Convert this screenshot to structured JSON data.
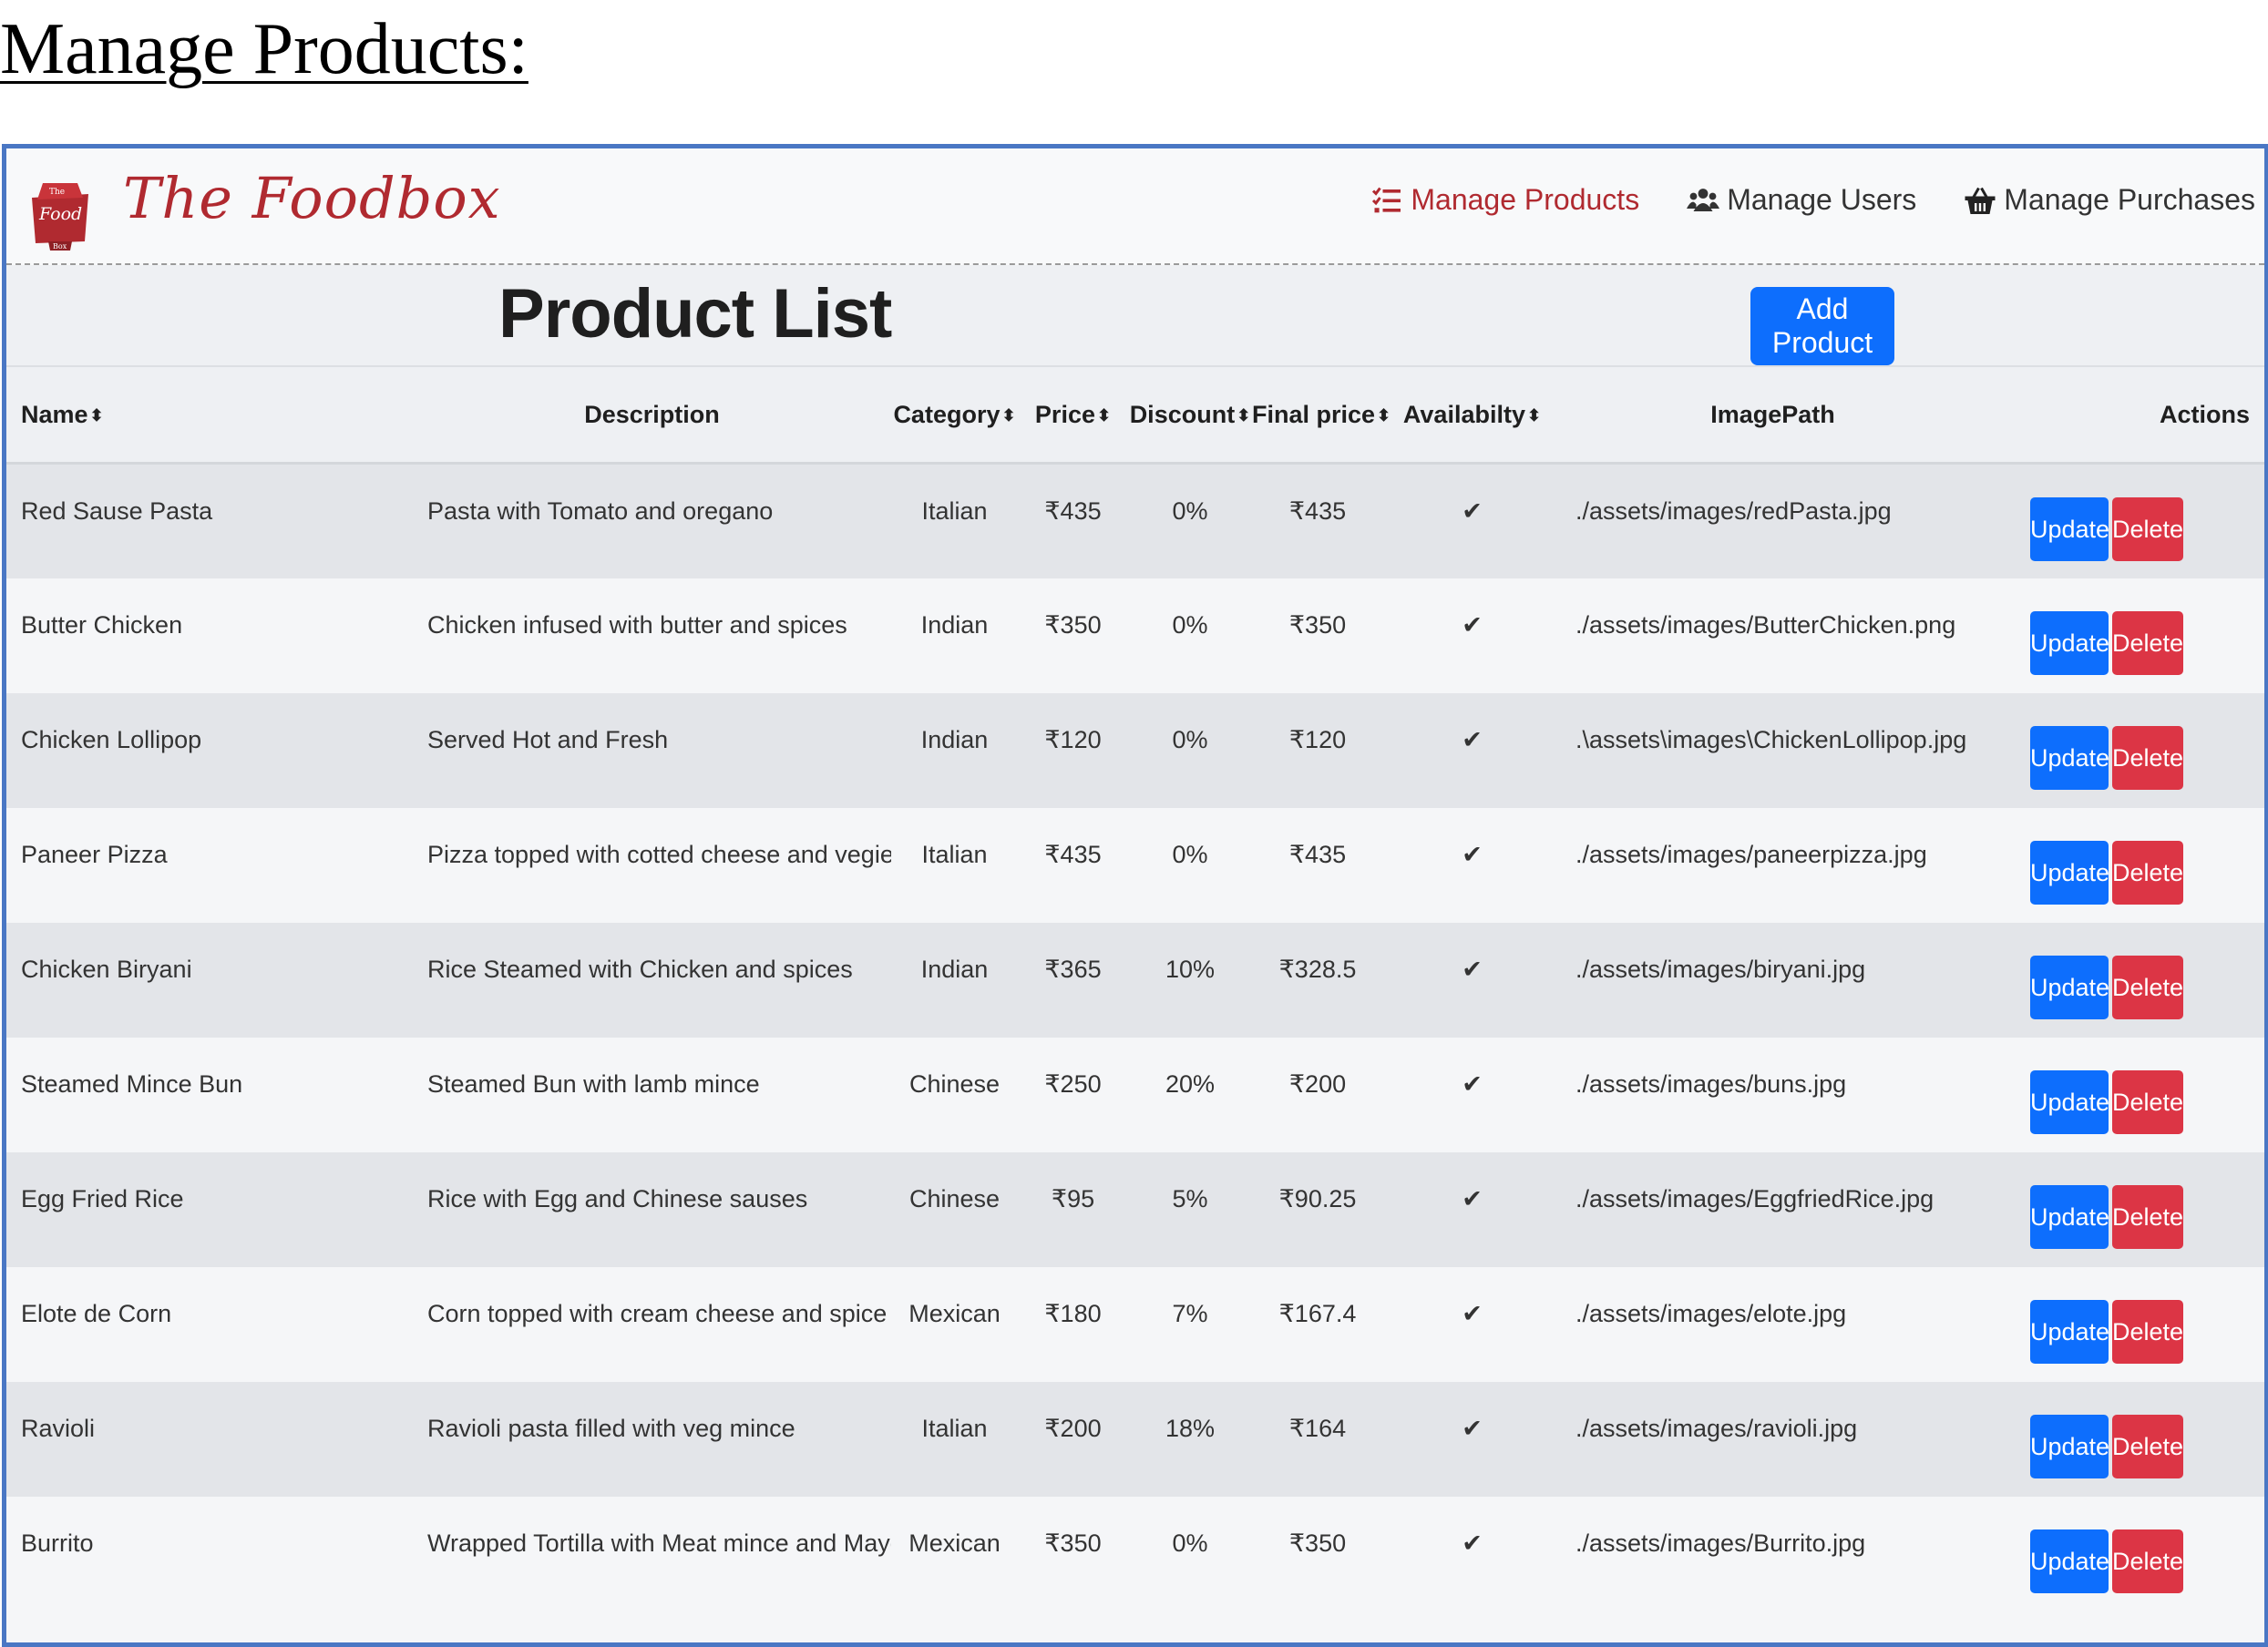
{
  "doc_heading": "Manage Products:",
  "app": {
    "logo_badge_text": [
      "The",
      "Food",
      "Box"
    ],
    "logo_text": "The Foodbox",
    "brand_color": "#b02a30",
    "nav": [
      {
        "label": "Manage Products",
        "icon": "list-check-icon",
        "active": true
      },
      {
        "label": "Manage Users",
        "icon": "users-icon",
        "active": false
      },
      {
        "label": "Manage Purchases",
        "icon": "shopping-basket-icon",
        "active": false
      }
    ]
  },
  "page": {
    "title": "Product List",
    "add_button": "Add Product"
  },
  "table": {
    "columns": {
      "name": "Name",
      "description": "Description",
      "category": "Category",
      "price": "Price",
      "discount": "Discount",
      "final_price": "Final price",
      "availability": "Availabilty",
      "image_path": "ImagePath",
      "actions": "Actions"
    },
    "sort_icon": "sort-icon",
    "update_label": "Update",
    "delete_label": "Delete",
    "rows": [
      {
        "name": "Red Sause Pasta",
        "description": "Pasta with Tomato and oregano",
        "category": "Italian",
        "price": "₹435",
        "discount": "0%",
        "final_price": "₹435",
        "available": "✔",
        "image_path": "./assets/images/redPasta.jpg"
      },
      {
        "name": "Butter Chicken",
        "description": "Chicken infused with butter and spices",
        "category": "Indian",
        "price": "₹350",
        "discount": "0%",
        "final_price": "₹350",
        "available": "✔",
        "image_path": "./assets/images/ButterChicken.png"
      },
      {
        "name": "Chicken Lollipop",
        "description": "Served Hot and Fresh",
        "category": "Indian",
        "price": "₹120",
        "discount": "0%",
        "final_price": "₹120",
        "available": "✔",
        "image_path": ".\\assets\\images\\ChickenLollipop.jpg"
      },
      {
        "name": "Paneer Pizza",
        "description": "Pizza topped with cotted cheese and vegies",
        "category": "Italian",
        "price": "₹435",
        "discount": "0%",
        "final_price": "₹435",
        "available": "✔",
        "image_path": "./assets/images/paneerpizza.jpg"
      },
      {
        "name": "Chicken Biryani",
        "description": "Rice Steamed with Chicken and spices",
        "category": "Indian",
        "price": "₹365",
        "discount": "10%",
        "final_price": "₹328.5",
        "available": "✔",
        "image_path": "./assets/images/biryani.jpg"
      },
      {
        "name": "Steamed Mince Bun",
        "description": "Steamed Bun with lamb mince",
        "category": "Chinese",
        "price": "₹250",
        "discount": "20%",
        "final_price": "₹200",
        "available": "✔",
        "image_path": "./assets/images/buns.jpg"
      },
      {
        "name": "Egg Fried Rice",
        "description": "Rice with Egg and Chinese sauses",
        "category": "Chinese",
        "price": "₹95",
        "discount": "5%",
        "final_price": "₹90.25",
        "available": "✔",
        "image_path": "./assets/images/EggfriedRice.jpg"
      },
      {
        "name": "Elote de Corn",
        "description": "Corn topped with cream cheese and spice",
        "category": "Mexican",
        "price": "₹180",
        "discount": "7%",
        "final_price": "₹167.4",
        "available": "✔",
        "image_path": "./assets/images/elote.jpg"
      },
      {
        "name": "Ravioli",
        "description": "Ravioli pasta filled with veg mince",
        "category": "Italian",
        "price": "₹200",
        "discount": "18%",
        "final_price": "₹164",
        "available": "✔",
        "image_path": "./assets/images/ravioli.jpg"
      },
      {
        "name": "Burrito",
        "description": "Wrapped Tortilla with Meat mince and Mayo",
        "category": "Mexican",
        "price": "₹350",
        "discount": "0%",
        "final_price": "₹350",
        "available": "✔",
        "image_path": "./assets/images/Burrito.jpg"
      }
    ]
  },
  "colors": {
    "primary": "#0d6efd",
    "danger": "#dc3545",
    "frame_border": "#4a77c4"
  }
}
